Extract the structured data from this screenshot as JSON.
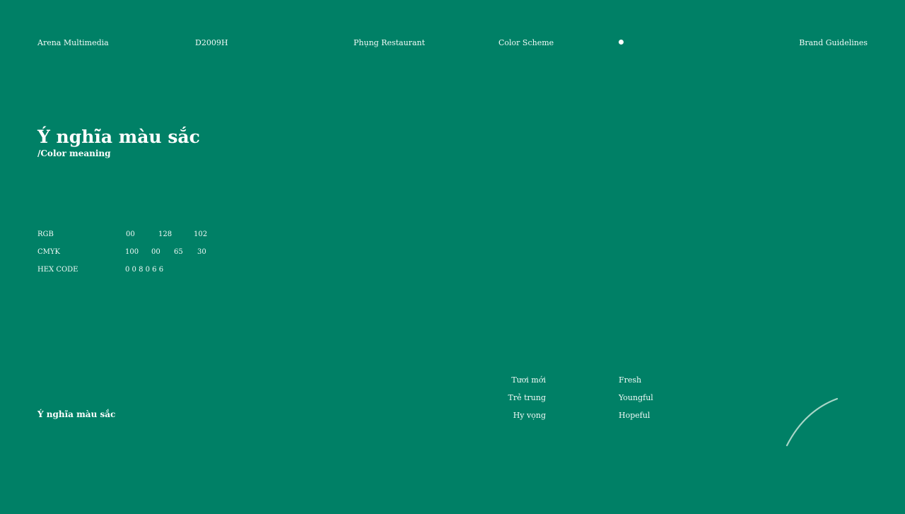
{
  "colors": {
    "background": "#008066",
    "text": "#ffffff",
    "arc": "#a9d6c8"
  },
  "header": {
    "org": "Arena Multimedia",
    "class_code": "D2009H",
    "project": "Phụng Restaurant",
    "section": "Color Scheme",
    "doc": "Brand Guidelines"
  },
  "main": {
    "title": "Ý nghĩa màu sắc",
    "subtitle": "/Color meaning"
  },
  "color_spec": {
    "rgb": {
      "label": "RGB",
      "values": [
        "00",
        "128",
        "102"
      ]
    },
    "cmyk": {
      "label": "CMYK",
      "values": [
        "100",
        "00",
        "65",
        "30"
      ]
    },
    "hex": {
      "label": "HEX CODE",
      "value": "0 0 8 0 6 6"
    }
  },
  "footer": {
    "title": "Ý nghĩa màu sắc"
  },
  "meanings": [
    {
      "vi": "Tươi mới",
      "en": "Fresh"
    },
    {
      "vi": "Trẻ trung",
      "en": "Youngful"
    },
    {
      "vi": "Hy vọng",
      "en": "Hopeful"
    }
  ],
  "decoration": {
    "arc_icon": "arc-decoration-icon"
  }
}
